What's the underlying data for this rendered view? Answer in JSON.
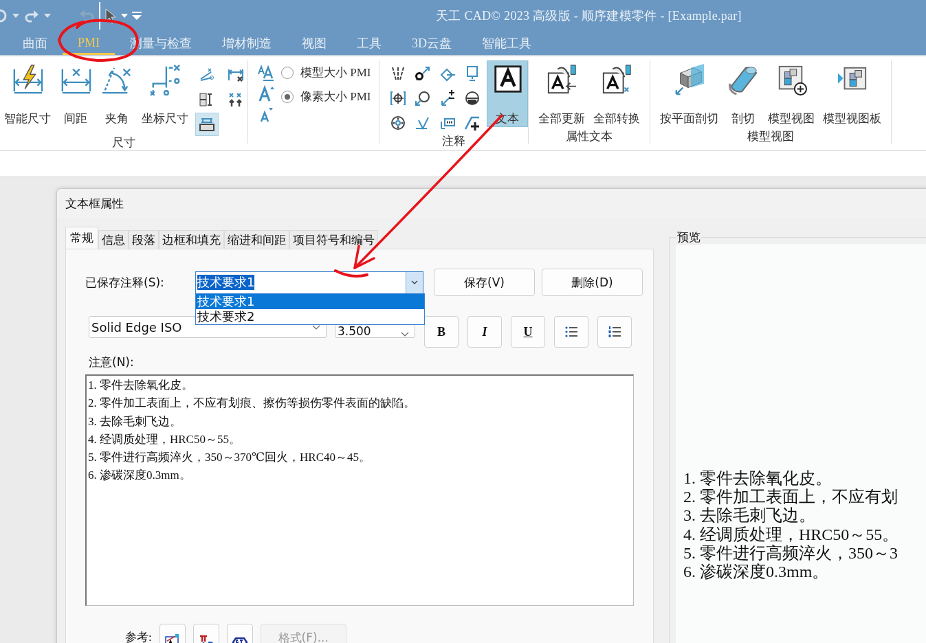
{
  "window": {
    "title": "天工 CAD© 2023 高级版 - 顺序建模零件 - [Example.par]"
  },
  "ribbon_tabs": [
    {
      "label": "曲面",
      "selected": false
    },
    {
      "label": "PMI",
      "selected": true
    },
    {
      "label": "测量与检查",
      "selected": false
    },
    {
      "label": "增材制造",
      "selected": false
    },
    {
      "label": "视图",
      "selected": false
    },
    {
      "label": "工具",
      "selected": false
    },
    {
      "label": "3D云盘",
      "selected": false
    },
    {
      "label": "智能工具",
      "selected": false
    }
  ],
  "ribbon": {
    "groups": [
      {
        "kind": "dimension",
        "label": "尺寸",
        "buttons": [
          {
            "label": "智能尺寸",
            "selected": false
          },
          {
            "label": "间距",
            "selected": false
          },
          {
            "label": "夹角",
            "selected": false
          },
          {
            "label": "坐标尺寸",
            "selected": false
          }
        ],
        "small_tools": [
          {
            "on": false
          },
          {
            "on": false
          },
          {
            "on": true
          },
          {
            "on": false
          },
          {
            "on": false
          }
        ]
      },
      {
        "kind": "size",
        "options": [
          {
            "label": "模型大小 PMI",
            "selected": false
          },
          {
            "label": "像素大小 PMI",
            "selected": true
          }
        ]
      },
      {
        "kind": "annotation",
        "label": "注释",
        "buttons": [
          {
            "label": "文本",
            "selected": true
          }
        ]
      },
      {
        "kind": "buttons",
        "label": "属性文本",
        "buttons": [
          {
            "label": "全部更新",
            "selected": false
          },
          {
            "label": "全部转换",
            "selected": false
          }
        ]
      },
      {
        "kind": "buttons",
        "label": "模型视图",
        "buttons": [
          {
            "label": "按平面剖切",
            "selected": false
          },
          {
            "label": "剖切",
            "selected": false
          },
          {
            "label": "模型视图",
            "selected": false
          },
          {
            "label": "模型视图板",
            "selected": false
          }
        ]
      }
    ]
  },
  "dialog": {
    "title": "文本框属性",
    "tabs": [
      {
        "label": "常规",
        "selected": true
      },
      {
        "label": "信息",
        "selected": false
      },
      {
        "label": "段落",
        "selected": false
      },
      {
        "label": "边框和填充",
        "selected": false
      },
      {
        "label": "缩进和间距",
        "selected": false
      },
      {
        "label": "项目符号和编号",
        "selected": false
      }
    ],
    "saved_notes": {
      "label": "已保存注释(S):",
      "value": "技术要求1",
      "expanded": true,
      "options": [
        {
          "text": "技术要求1",
          "selected": true
        },
        {
          "text": "技术要求2",
          "selected": false
        }
      ]
    },
    "save_button": "保存(V)",
    "delete_button": "删除(D)",
    "font": {
      "value": "Solid Edge ISO"
    },
    "size": {
      "value": "3.500"
    },
    "format_buttons": [
      {
        "kind": "bold",
        "label": "B"
      },
      {
        "kind": "italic",
        "label": "I"
      },
      {
        "kind": "underline",
        "label": "U"
      },
      {
        "kind": "bullets"
      },
      {
        "kind": "numbering"
      }
    ],
    "notes": {
      "label": "注意(N):",
      "lines": [
        "1. 零件去除氧化皮。",
        "2. 零件加工表面上，不应有划痕、擦伤等损伤零件表面的缺陷。",
        "3. 去除毛刺飞边。",
        "4. 经调质处理，HRC50～55。",
        "5. 零件进行高频淬火，350～370℃回火，HRC40～45。",
        "6. 渗碳深度0.3mm。"
      ]
    },
    "reference": {
      "label": "参考:",
      "format_button": {
        "label": "格式(F)...",
        "disabled": true
      }
    },
    "preview": {
      "label": "预览",
      "lines": [
        "1. 零件去除氧化皮。",
        "2. 零件加工表面上，不应有划",
        "3. 去除毛刺飞边。",
        "4. 经调质处理，HRC50～55。",
        "5. 零件进行高频淬火，350～3",
        "6. 渗碳深度0.3mm。"
      ]
    }
  }
}
